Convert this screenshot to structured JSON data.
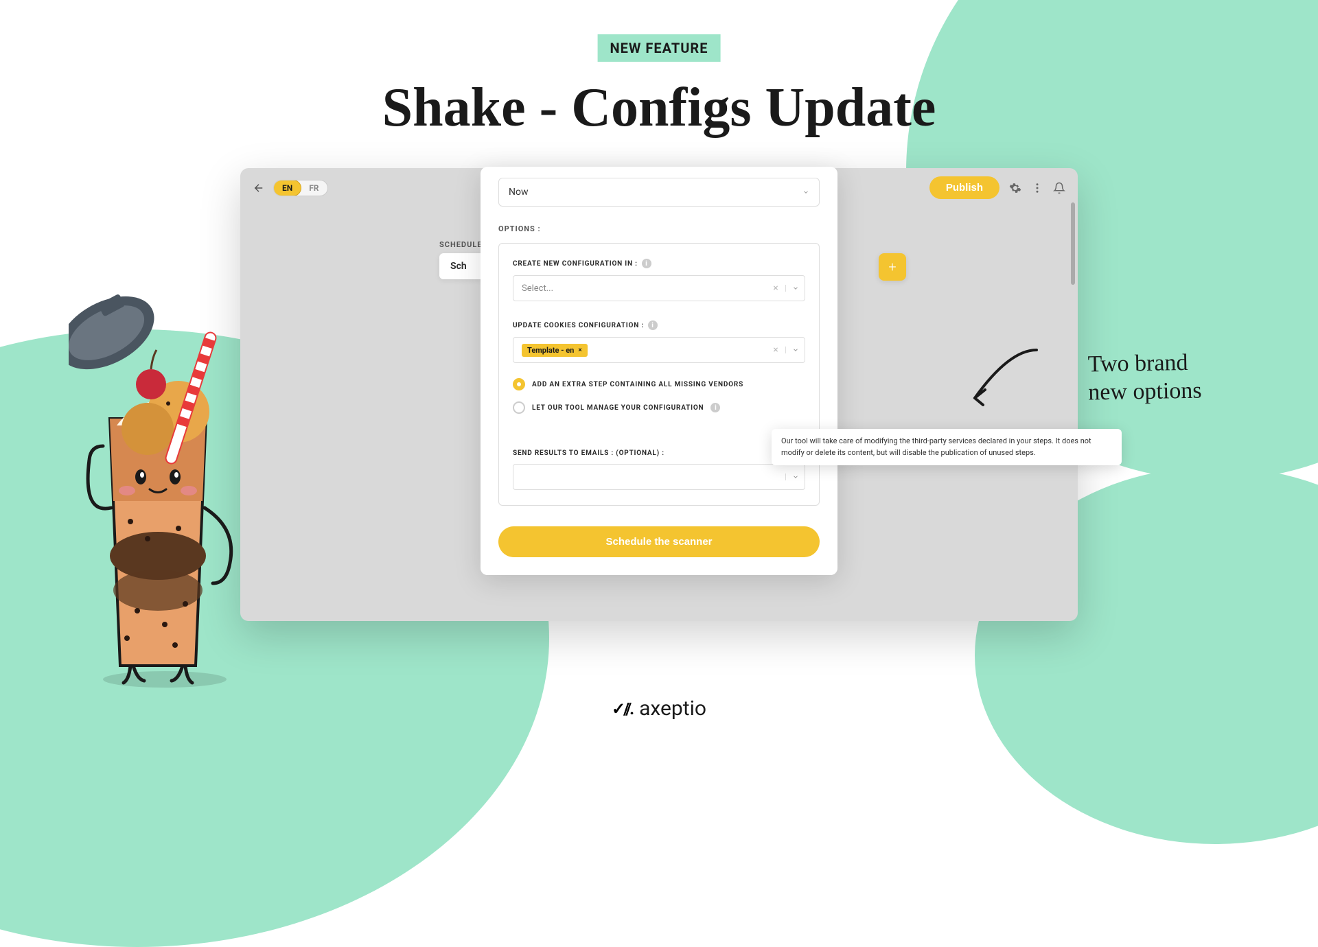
{
  "hero": {
    "badge": "NEW FEATURE",
    "title": "Shake - Configs Update"
  },
  "topbar": {
    "lang": {
      "active": "EN",
      "inactive": "FR"
    },
    "publish": "Publish"
  },
  "sidebar": {
    "schedule_label": "SCHEDULE",
    "schedule_card": "Sch"
  },
  "modal": {
    "now": "Now",
    "options_label": "OPTIONS :",
    "create_label": "CREATE NEW CONFIGURATION IN :",
    "select_placeholder": "Select...",
    "update_label": "UPDATE COOKIES CONFIGURATION :",
    "tag": "Template - en",
    "radio1": "ADD AN EXTRA STEP CONTAINING ALL MISSING VENDORS",
    "radio2": "LET OUR TOOL MANAGE YOUR CONFIGURATION",
    "tooltip": "Our tool will take care of modifying the third-party services declared in your steps. It does not modify or delete its content, but will disable the publication of unused steps.",
    "emails_label": "SEND RESULTS TO EMAILS : (OPTIONAL) :",
    "cta": "Schedule the scanner"
  },
  "annotation": {
    "line1": "Two brand",
    "line2": "new options"
  },
  "footer": {
    "brand": "axeptio"
  }
}
